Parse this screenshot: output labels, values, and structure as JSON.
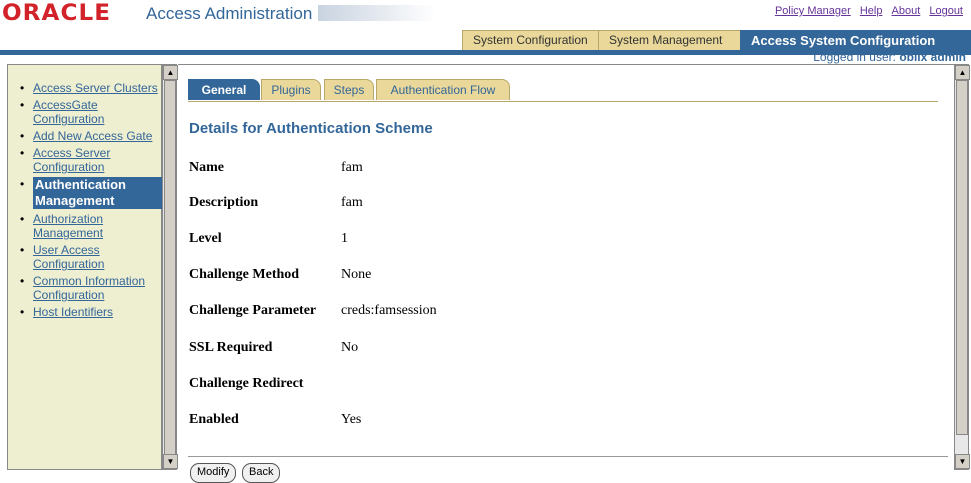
{
  "header": {
    "logo": "ORACLE",
    "app_title": "Access Administration",
    "links": [
      "Policy Manager",
      "Help",
      "About",
      "Logout"
    ],
    "tabs": [
      "System Configuration",
      "System Management",
      "Access System Configuration"
    ],
    "logged_in_label": "Logged in user:",
    "logged_in_user": "oblix admin"
  },
  "sidebar": {
    "items": [
      {
        "label": "Access Server Clusters"
      },
      {
        "label": "AccessGate Configuration"
      },
      {
        "label": "Add New Access Gate"
      },
      {
        "label": "Access Server Configuration"
      },
      {
        "label": "Authentication Management"
      },
      {
        "label": "Authorization Management"
      },
      {
        "label": "User Access Configuration"
      },
      {
        "label": "Common Information Configuration"
      },
      {
        "label": "Host Identifiers"
      }
    ],
    "active_index": 4
  },
  "subtabs": [
    "General",
    "Plugins",
    "Steps",
    "Authentication Flow"
  ],
  "section_title": "Details for Authentication Scheme",
  "fields": [
    {
      "label": "Name",
      "value": "fam"
    },
    {
      "label": "Description",
      "value": "fam"
    },
    {
      "label": "Level",
      "value": "1"
    },
    {
      "label": "Challenge Method",
      "value": "None"
    },
    {
      "label": "Challenge Parameter",
      "value": "creds:famsession"
    },
    {
      "label": "SSL Required",
      "value": "No"
    },
    {
      "label": "Challenge Redirect",
      "value": ""
    },
    {
      "label": "Enabled",
      "value": "Yes"
    }
  ],
  "buttons": [
    "Modify",
    "Back"
  ],
  "colors": {
    "accent": "#336699",
    "tab": "#e9d89a",
    "sidebar_bg": "#eeeed0",
    "logo": "#d2222a"
  }
}
